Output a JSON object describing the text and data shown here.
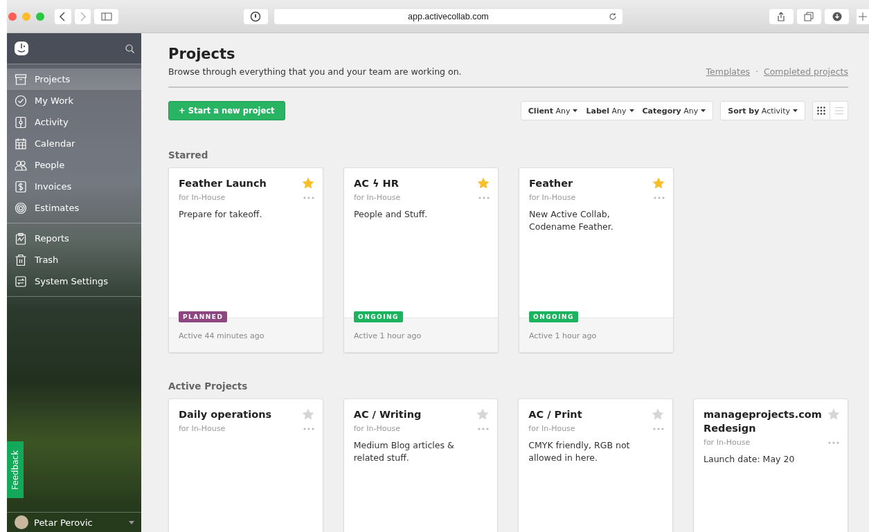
{
  "browser": {
    "url": "app.activecollab.com"
  },
  "sidebar": {
    "groups": [
      {
        "items": [
          {
            "label": "Projects",
            "selected": true
          },
          {
            "label": "My Work",
            "selected": false
          },
          {
            "label": "Activity",
            "selected": false
          },
          {
            "label": "Calendar",
            "selected": false
          },
          {
            "label": "People",
            "selected": false
          },
          {
            "label": "Invoices",
            "selected": false
          },
          {
            "label": "Estimates",
            "selected": false
          }
        ]
      },
      {
        "items": [
          {
            "label": "Reports",
            "selected": false
          },
          {
            "label": "Trash",
            "selected": false
          },
          {
            "label": "System Settings",
            "selected": false
          }
        ]
      }
    ],
    "feedback": "Feedback",
    "user": "Petar Perovic"
  },
  "header": {
    "title": "Projects",
    "subtitle": "Browse through everything that you and your team are working on.",
    "links": [
      "Templates",
      "Completed projects"
    ],
    "separator": "·"
  },
  "toolbar": {
    "new_button": "+ Start a new project",
    "filters": [
      {
        "label": "Client",
        "value": "Any"
      },
      {
        "label": "Label",
        "value": "Any"
      },
      {
        "label": "Category",
        "value": "Any"
      }
    ],
    "sort": {
      "label": "Sort by",
      "value": "Activity"
    },
    "views": [
      {
        "kind": "grid",
        "selected": true
      },
      {
        "kind": "list",
        "selected": false
      }
    ]
  },
  "sections": [
    {
      "title": "Starred",
      "projects": [
        {
          "name": "Feather Launch",
          "client": "for In-House",
          "description": "Prepare for takeoff.",
          "starred": true,
          "status": "PLANNED",
          "color": "#8e4680",
          "activity": "Active 44 minutes ago"
        },
        {
          "name": "AC ϟ HR",
          "client": "for In-House",
          "description": "People and Stuff.",
          "starred": true,
          "status": "ONGOING",
          "color": "#1cb35e",
          "activity": "Active 1 hour ago"
        },
        {
          "name": "Feather",
          "client": "for In-House",
          "description": "New Active Collab, Codename Feather.",
          "starred": true,
          "status": "ONGOING",
          "color": "#1cb35e",
          "activity": "Active 1 hour ago"
        }
      ]
    },
    {
      "title": "Active Projects",
      "projects": [
        {
          "name": "Daily operations",
          "client": "for In-House",
          "starred": false
        },
        {
          "name": "AC / Writing",
          "client": "for In-House",
          "description": "Medium Blog articles & related stuff.",
          "starred": false
        },
        {
          "name": "AC / Print",
          "client": "for In-House",
          "description": "CMYK friendly, RGB not allowed in here.",
          "starred": false
        },
        {
          "name": "manageprojects.com Redesign",
          "client": "for In-House",
          "description": "Launch date: May 20",
          "starred": false
        }
      ]
    }
  ]
}
